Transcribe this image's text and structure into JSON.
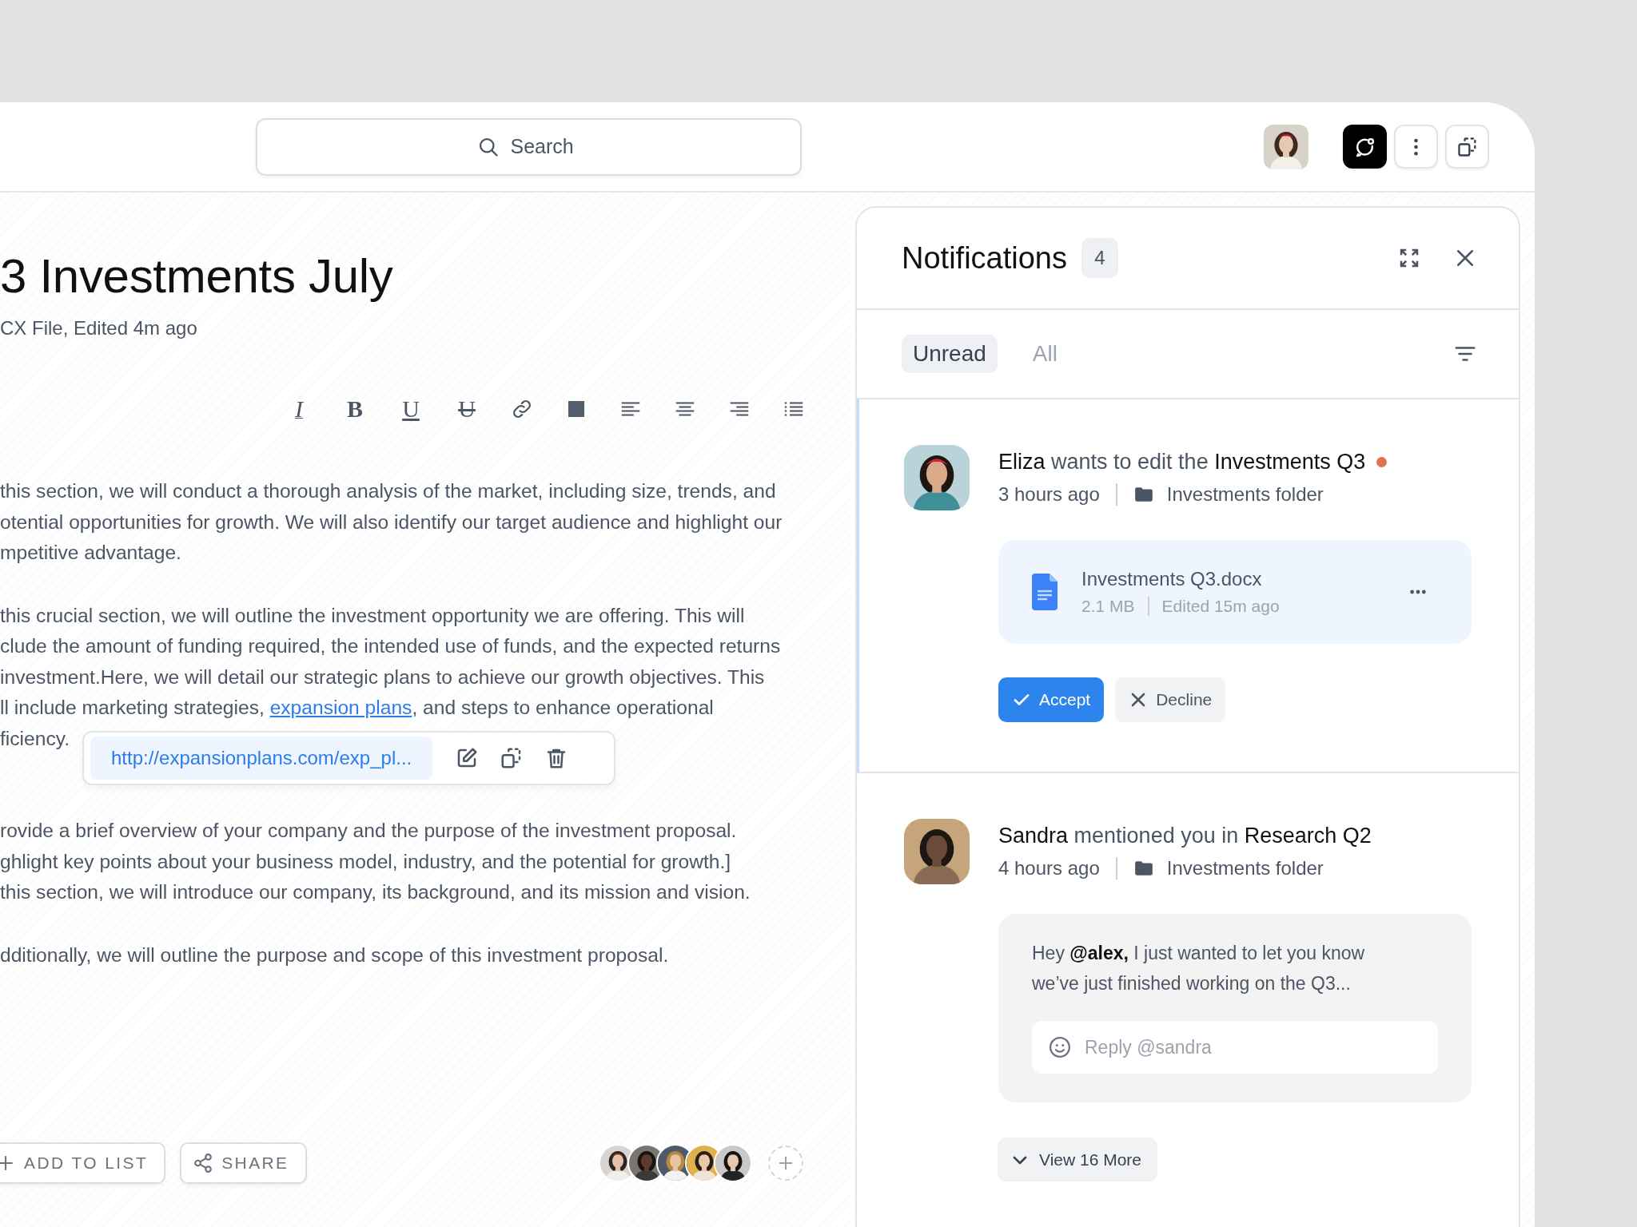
{
  "search": {
    "placeholder": "Search"
  },
  "document": {
    "title": "3 Investments July",
    "subtitle": "CX File, Edited 4m ago",
    "toolbar": [
      {
        "kind": "italic",
        "glyph": "I"
      },
      {
        "kind": "bold",
        "glyph": "B"
      },
      {
        "kind": "underline",
        "glyph": "U"
      },
      {
        "kind": "strikethrough",
        "glyph": "U"
      },
      {
        "kind": "link"
      },
      {
        "kind": "color"
      },
      {
        "kind": "align-left"
      },
      {
        "kind": "align-center"
      },
      {
        "kind": "align-right"
      },
      {
        "kind": "list"
      }
    ],
    "paragraphs": [
      {
        "lines": [
          {
            "text": "this section, we will conduct a thorough analysis of the market, including size, trends, and"
          },
          {
            "text": "otential opportunities for growth. We will also identify our target audience and highlight our"
          },
          {
            "text": "mpetitive advantage."
          }
        ]
      },
      {
        "lines": [
          {
            "text": "this crucial section, we will outline the investment opportunity we are offering. This will"
          },
          {
            "text": "clude the amount of funding required, the intended use of funds, and the expected returns"
          },
          {
            "text": "investment.Here, we will detail our strategic plans to achieve our growth objectives. This"
          },
          {
            "text": "ll include marketing strategies, ",
            "link": "expansion plans",
            "after": ", and steps to enhance operational"
          },
          {
            "text": "ficiency."
          }
        ]
      },
      {
        "lines": [
          {
            "text": "rovide a brief overview of your company and the purpose of the investment proposal."
          },
          {
            "text": "ghlight key points about your business model, industry, and the potential for growth.]"
          },
          {
            "text": "this section, we will introduce our company, its background, and its mission and vision."
          }
        ]
      },
      {
        "lines": [
          {
            "text": "dditionally, we will outline the purpose and scope of this investment proposal."
          }
        ]
      }
    ],
    "link_popover": {
      "url": "http://expansionplans.com/exp_pl..."
    },
    "actions": [
      {
        "kind": "add",
        "label": "ADD TO LIST"
      },
      {
        "kind": "share",
        "label": "SHARE"
      }
    ]
  },
  "notifications": {
    "title": "Notifications",
    "count": "4",
    "tabs": [
      {
        "label": "Unread",
        "selected": true
      },
      {
        "label": "All",
        "selected": false
      }
    ],
    "items": [
      {
        "kind": "file_request",
        "title": "**Eliza** wants to edit the **Investments Q3**",
        "unread": true,
        "selected": true,
        "time": "3 hours ago",
        "folder": "Investments folder",
        "file": {
          "name": "Investments Q3.docx",
          "size": "2.1 MB",
          "edited": "Edited 15m ago"
        },
        "buttons": [
          {
            "kind": "accept",
            "label": "Accept"
          },
          {
            "kind": "decline",
            "label": "Decline"
          }
        ]
      },
      {
        "kind": "mention",
        "title": "**Sandra** mentioned you in **Research Q2**",
        "unread": false,
        "selected": false,
        "time": "4 hours ago",
        "folder": "Investments folder",
        "message": "Hey **@alex,** I just wanted to let you know we’ve just finished working on the Q3...",
        "reply_placeholder": "Reply @sandra"
      }
    ],
    "more_button": "View 16 More"
  }
}
